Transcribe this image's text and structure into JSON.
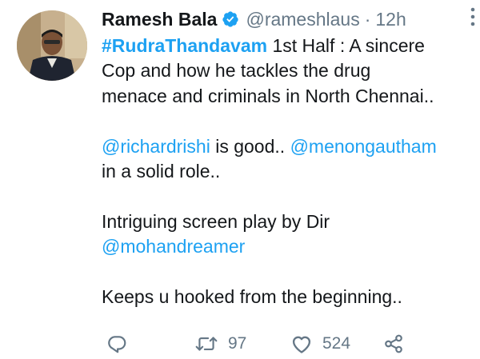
{
  "author": {
    "name": "Ramesh Bala",
    "handle": "@rameshlaus",
    "separator": "·",
    "time": "12h"
  },
  "tweet": {
    "line1": {
      "hashtag": "#RudraThandavam",
      "text": " 1st Half : A sincere"
    },
    "line2": "Cop and how he tackles the drug",
    "line3": "menace and criminals in North Chennai..",
    "line4": {
      "mention": "@richardrishi",
      "middle": " is good.. ",
      "mention2": "@menongautham"
    },
    "line5": "in a solid role..",
    "line6": "Intriguing screen play by Dir",
    "line7": {
      "mention": "@mohandreamer"
    },
    "line8": "Keeps u hooked from the beginning.."
  },
  "actions": {
    "retweet_count": "97",
    "like_count": "524"
  },
  "icons": {
    "verified": "verified-badge-icon",
    "more": "more-vertical-icon",
    "reply": "reply-icon",
    "retweet": "retweet-icon",
    "like": "heart-icon",
    "share": "share-icon"
  },
  "colors": {
    "link": "#1da1f2",
    "muted": "#657786",
    "text": "#14171a"
  }
}
